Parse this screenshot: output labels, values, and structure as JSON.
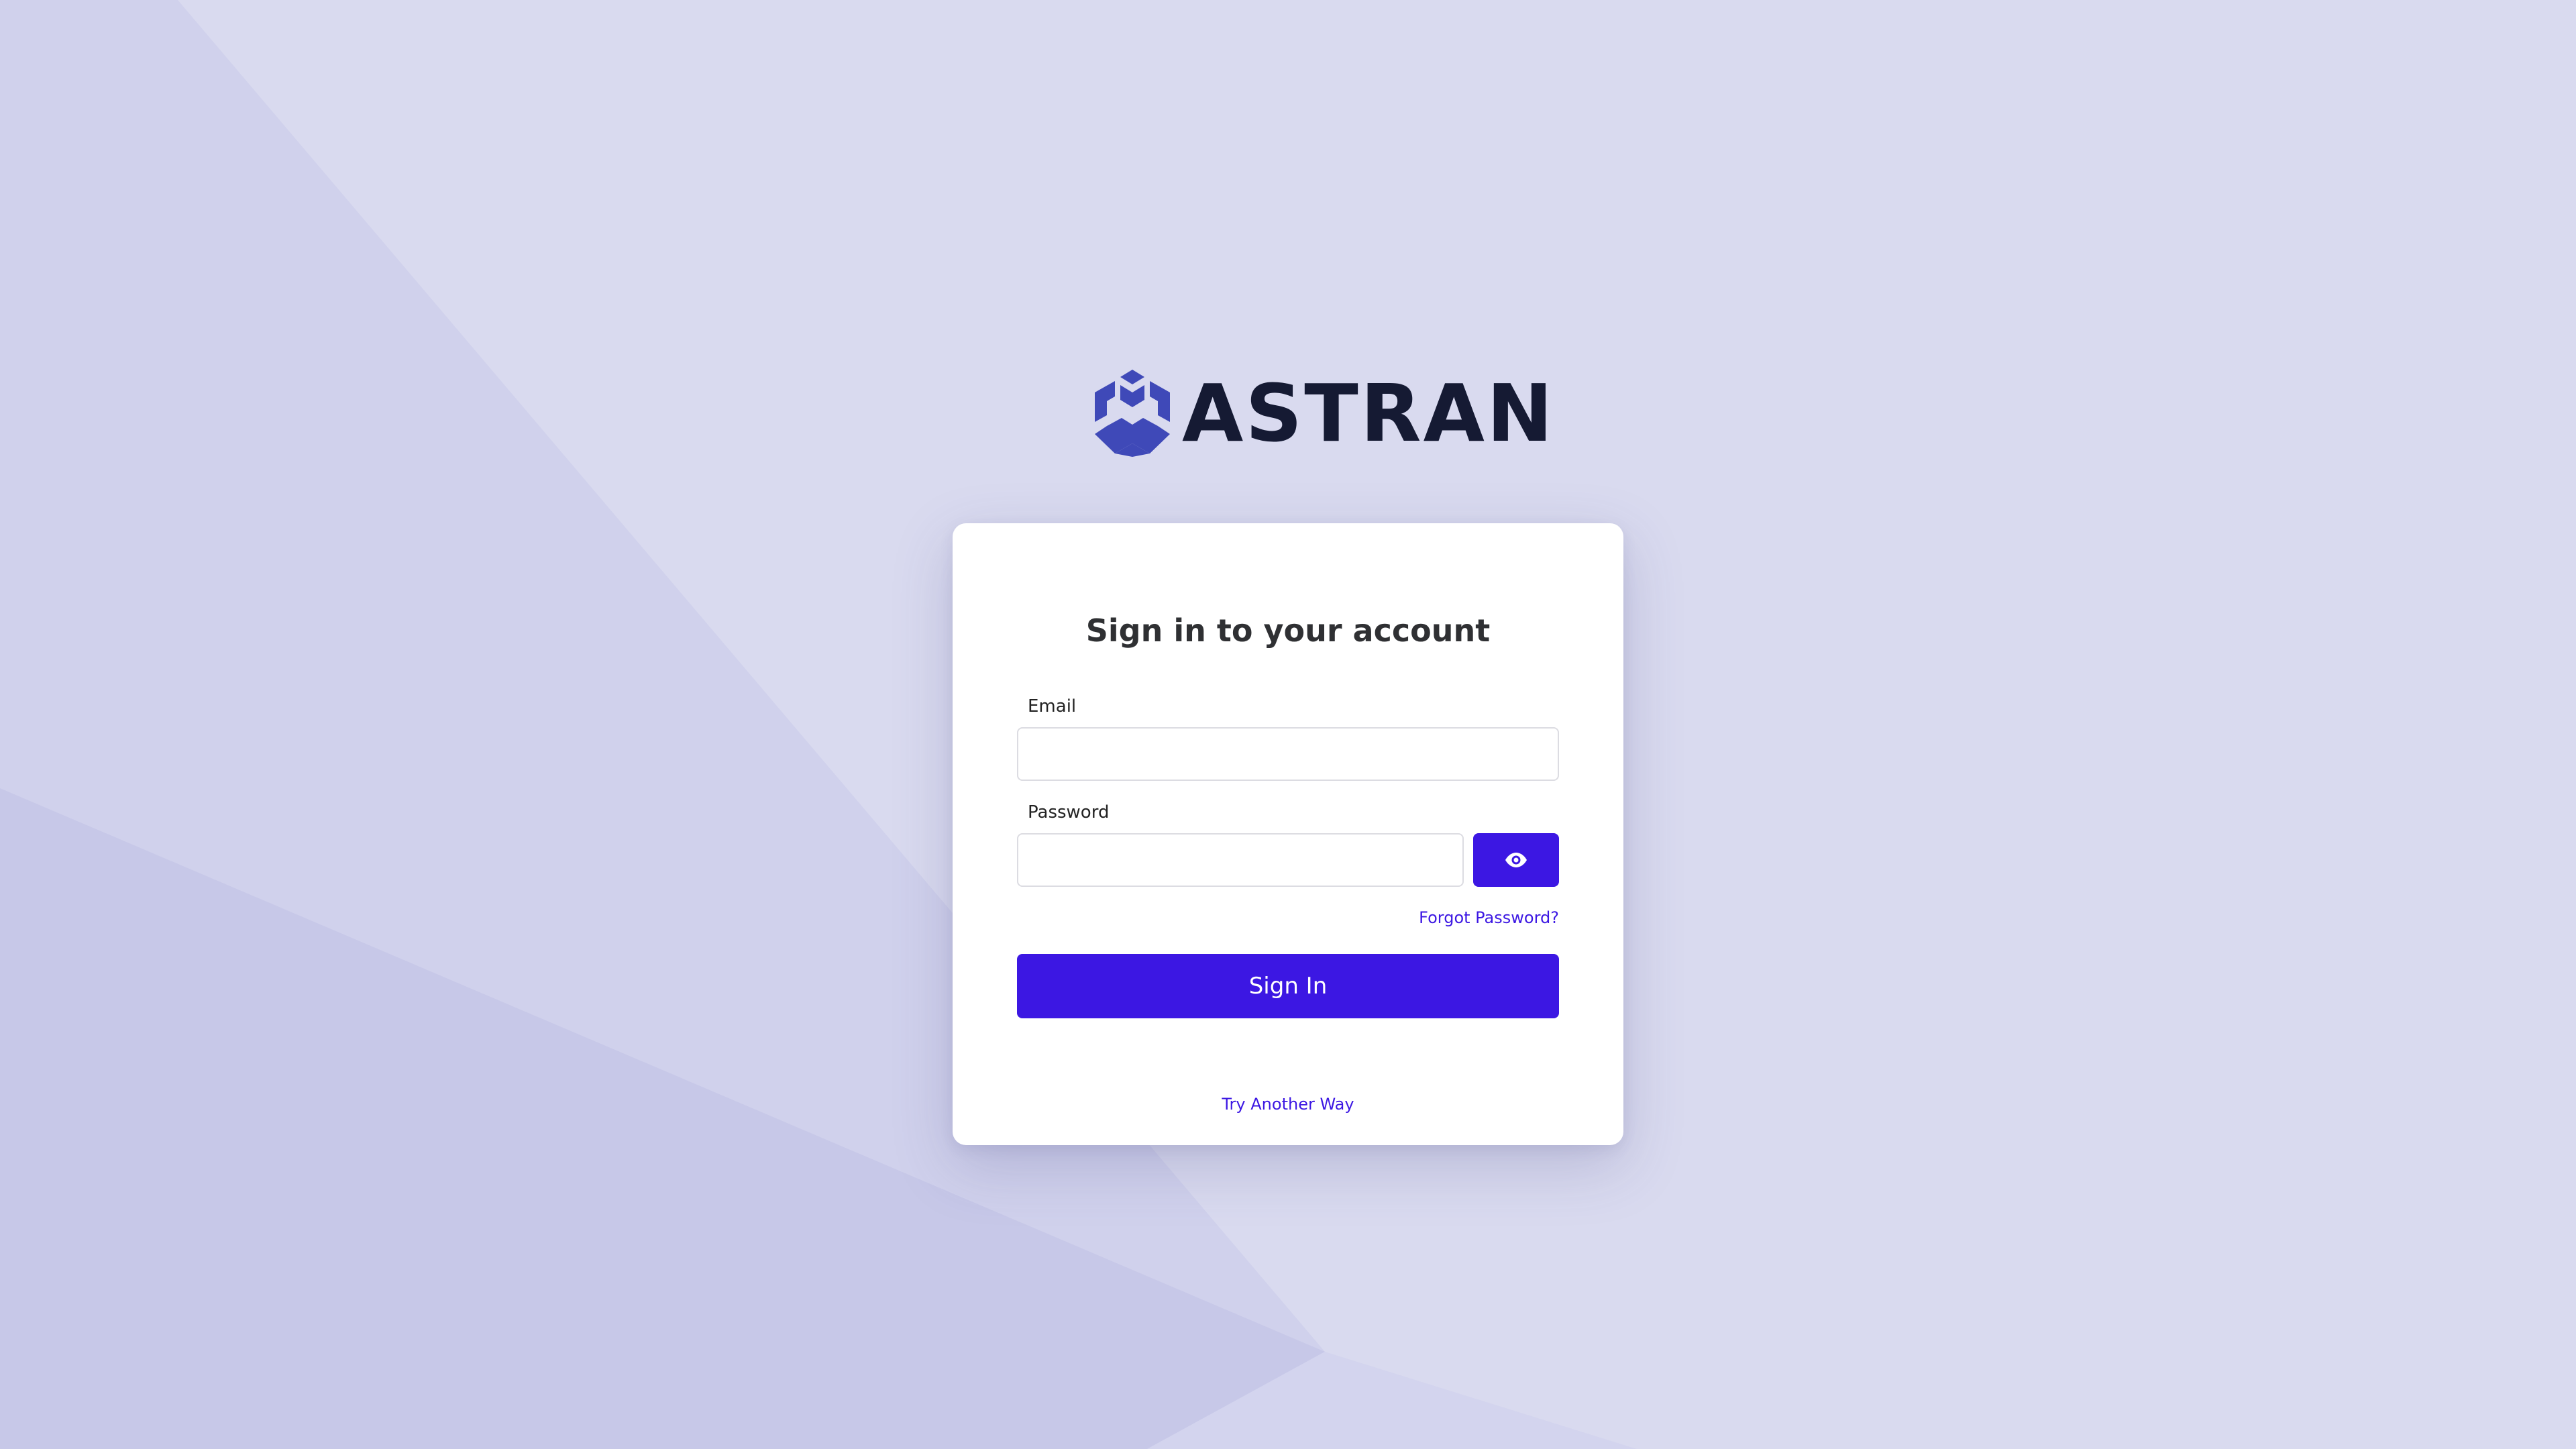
{
  "brand": {
    "name": "ASTRAN",
    "logo_icon": "hexagon-cube-logo-icon",
    "logo_color": "#3f49b8",
    "text_color": "#151a33"
  },
  "login_card": {
    "title": "Sign in to your account",
    "email": {
      "label": "Email",
      "value": "",
      "placeholder": ""
    },
    "password": {
      "label": "Password",
      "value": "",
      "placeholder": "",
      "toggle_icon": "eye-icon"
    },
    "forgot_password_label": "Forgot Password?",
    "sign_in_label": "Sign In",
    "try_another_way_label": "Try Another Way"
  },
  "colors": {
    "accent": "#3c17e3",
    "background": "#d9daef",
    "card": "#ffffff"
  }
}
